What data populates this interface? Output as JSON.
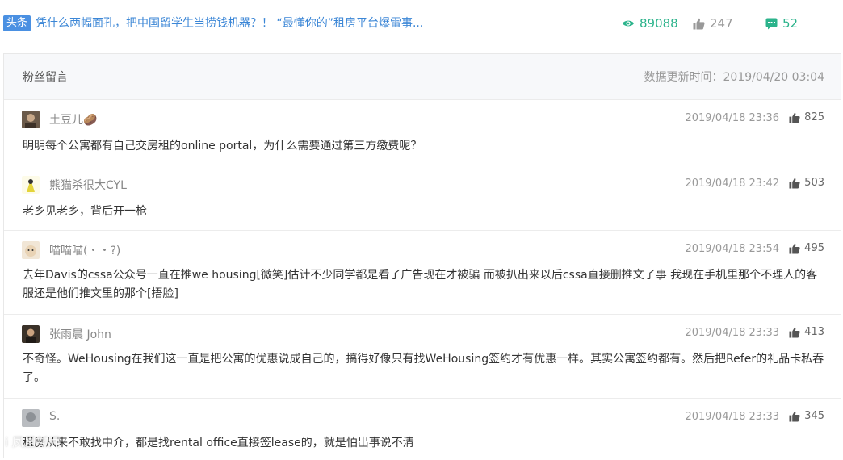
{
  "headline": {
    "tag": "头条",
    "title": "凭什么两幅面孔，把中国留学生当捞钱机器？！ “最懂你的”租房平台爆雷事...",
    "views": "89088",
    "likes": "247",
    "comments": "52"
  },
  "panel": {
    "title": "粉丝留言",
    "update_time": "数据更新时间：2019/04/20 03:04"
  },
  "comments": [
    {
      "name": "土豆儿🥔",
      "time": "2019/04/18 23:36",
      "likes": "825",
      "text": "明明每个公寓都有自己交房租的online portal，为什么需要通过第三方缴费呢？"
    },
    {
      "name": "熊猫杀很大CYL",
      "time": "2019/04/18 23:42",
      "likes": "503",
      "text": "老乡见老乡，背后开一枪"
    },
    {
      "name": "喵喵喵(・・?)",
      "time": "2019/04/18 23:54",
      "likes": "495",
      "text": "去年Davis的cssa公众号一直在推we housing[微笑]估计不少同学都是看了广告现在才被骗 而被扒出来以后cssa直接删推文了事 我现在手机里那个不理人的客服还是他们推文里的那个[捂脸]"
    },
    {
      "name": "张雨晨 John",
      "time": "2019/04/18 23:33",
      "likes": "413",
      "text": "不奇怪。WeHousing在我们这一直是把公寓的优惠说成自己的，搞得好像只有找WeHousing签约才有优惠一样。其实公寓签约都有。然后把Refer的礼品卡私吞了。"
    },
    {
      "name": "S.",
      "time": "2019/04/18 23:33",
      "likes": "345",
      "text": "租房从来不敢找中介，都是找rental office直接签lease的，就是怕出事说不清"
    }
  ],
  "watermark": "i 凤凰新闻",
  "colors": {
    "accent_green": "#2bb38b",
    "accent_blue": "#3b86d6",
    "tag_bg": "#4a90e2"
  },
  "icons": {
    "views": "eye-icon",
    "likes": "thumbs-up-icon",
    "comments": "comment-bubble-icon"
  }
}
